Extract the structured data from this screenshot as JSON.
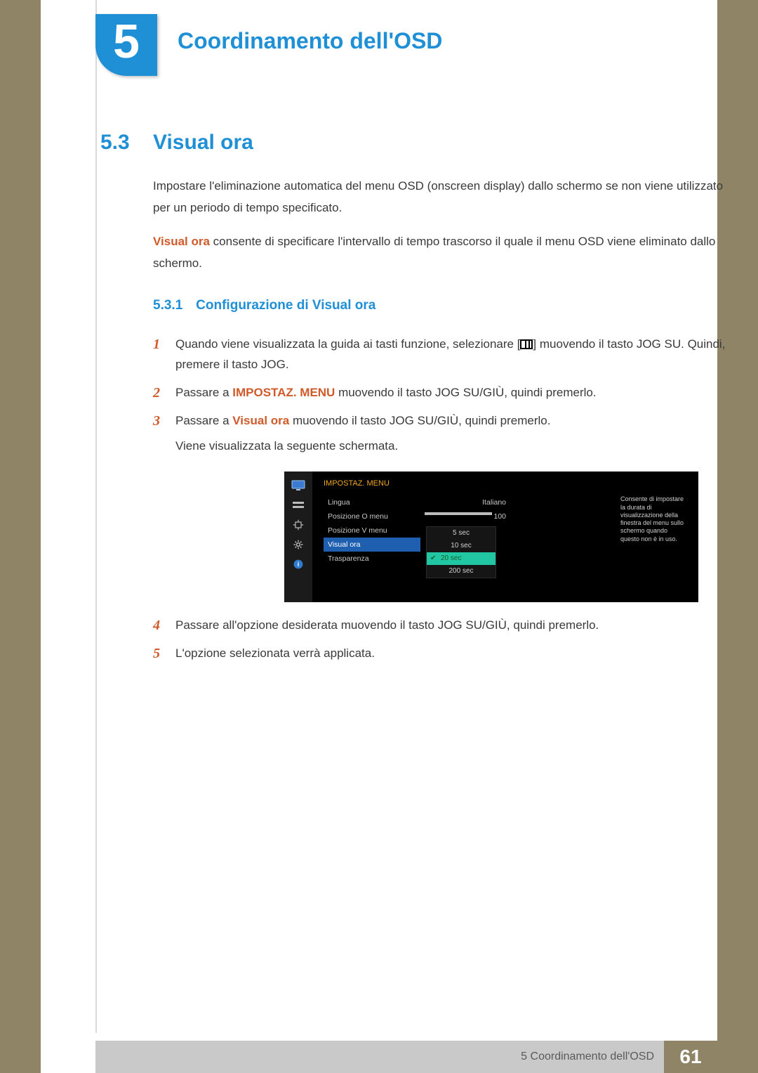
{
  "chapter": {
    "number": "5",
    "title": "Coordinamento dell'OSD"
  },
  "section": {
    "number": "5.3",
    "title": "Visual ora"
  },
  "intro": {
    "p1": "Impostare l'eliminazione automatica del menu OSD (onscreen display) dallo schermo se non viene utilizzato per un periodo di tempo specificato.",
    "p2_before": "Visual ora",
    "p2_after": " consente di specificare l'intervallo di tempo trascorso il quale il menu OSD viene eliminato dallo schermo."
  },
  "subsection": {
    "number": "5.3.1",
    "title": "Configurazione di Visual ora"
  },
  "steps": {
    "s1a": "Quando viene visualizzata la guida ai tasti funzione, selezionare [",
    "s1b": "] muovendo il tasto JOG SU. Quindi, premere il tasto JOG.",
    "s2a": "Passare a ",
    "s2_bold": "IMPOSTAZ. MENU",
    "s2b": " muovendo il tasto JOG SU/GIÙ, quindi premerlo.",
    "s3a": "Passare a ",
    "s3_bold": "Visual ora",
    "s3b": " muovendo il tasto JOG SU/GIÙ, quindi premerlo.",
    "s3c": "Viene visualizzata la seguente schermata.",
    "s4": "Passare all'opzione desiderata muovendo il tasto JOG SU/GIÙ, quindi premerlo.",
    "s5": "L'opzione selezionata verrà applicata."
  },
  "osd": {
    "header": "IMPOSTAZ. MENU",
    "menu": [
      "Lingua",
      "Posizione O menu",
      "Posizione V menu",
      "Visual ora",
      "Trasparenza"
    ],
    "values": {
      "lingua": "Italiano",
      "posO": "100"
    },
    "popup": [
      "5 sec",
      "10 sec",
      "20 sec",
      "200 sec"
    ],
    "popup_selected_index": 2,
    "hint": "Consente di impostare la durata di visualizzazione della finestra del menu sullo schermo quando questo non è in uso."
  },
  "footer": {
    "text": "5 Coordinamento dell'OSD",
    "page": "61"
  }
}
